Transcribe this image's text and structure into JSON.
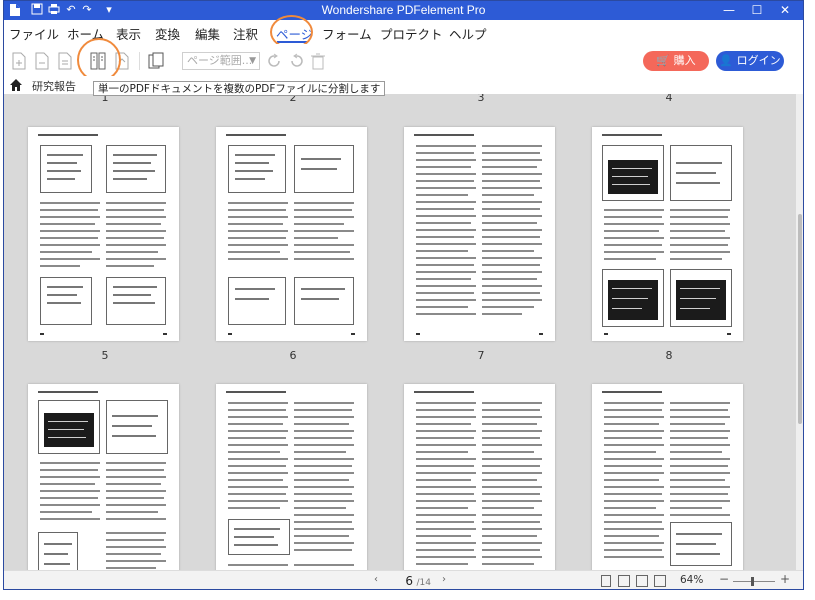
{
  "window": {
    "title": "Wondershare PDFelement Pro"
  },
  "menu": {
    "items": [
      "ファイル",
      "ホーム",
      "表示",
      "変換",
      "編集",
      "注釈",
      "ページ",
      "フォーム",
      "プロテクト",
      "ヘルプ"
    ],
    "active": "ページ"
  },
  "toolbar": {
    "page_range_placeholder": "ページ範囲...",
    "tooltip": "単一のPDFドキュメントを複数のPDFファイルに分割します",
    "buy_label": "購入",
    "login_label": "ログイン"
  },
  "breadcrumb": {
    "document": "研究報告"
  },
  "thumbnails": {
    "page_numbers": [
      "1",
      "2",
      "3",
      "4",
      "5",
      "6",
      "7",
      "8"
    ]
  },
  "status": {
    "current_page": "6",
    "total_pages": "/14",
    "zoom": "64%"
  },
  "colors": {
    "accent": "#2d5bd6",
    "highlight_circle": "#f08a3c",
    "buy_button": "#f4685a",
    "content_bg": "#d9d9d9"
  },
  "icons": [
    "app-icon",
    "save-icon",
    "print-icon",
    "undo-icon",
    "redo-icon",
    "dropdown-icon",
    "minimize-icon",
    "maximize-icon",
    "close-icon",
    "home-icon",
    "cart-icon",
    "user-icon",
    "rotate-left-icon",
    "rotate-right-icon",
    "delete-icon"
  ]
}
